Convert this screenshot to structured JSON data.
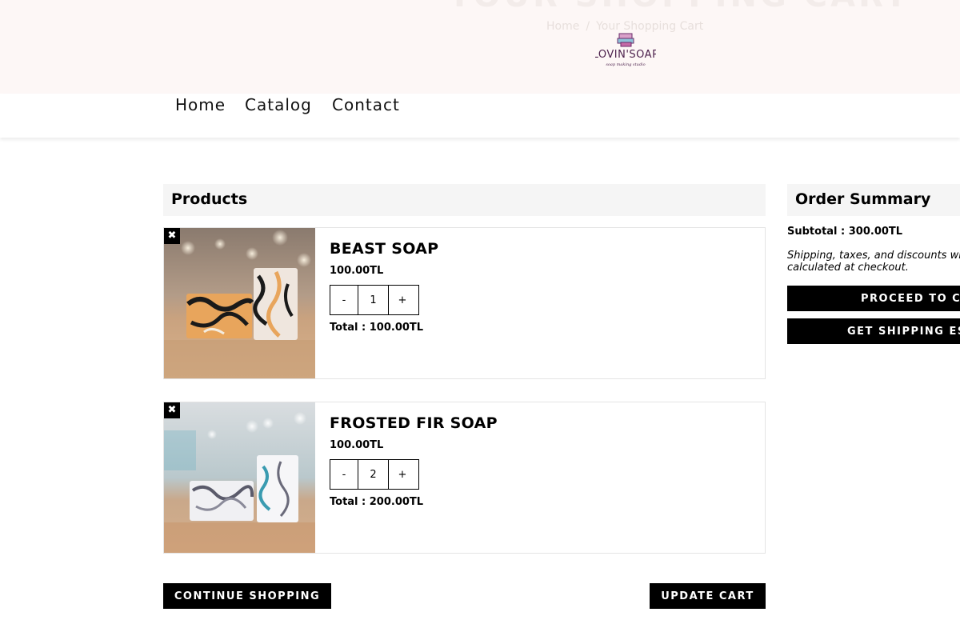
{
  "header": {
    "page_heading": "YOUR SHOPPING CART",
    "breadcrumb": [
      "Home",
      "Your Shopping Cart"
    ],
    "breadcrumb_sep": "/",
    "logo_text": "LOVIN'SOAP",
    "logo_tagline": "soap making studio"
  },
  "nav": {
    "items": [
      "Home",
      "Catalog",
      "Contact"
    ]
  },
  "products_section": {
    "heading": "Products",
    "items": [
      {
        "name": "BEAST SOAP",
        "price": "100.00TL",
        "qty_minus": "-",
        "qty": "1",
        "qty_plus": "+",
        "total": "Total : 100.00TL",
        "remove_icon": "✖"
      },
      {
        "name": "FROSTED FIR SOAP",
        "price": "100.00TL",
        "qty_minus": "-",
        "qty": "2",
        "qty_plus": "+",
        "total": "Total : 200.00TL",
        "remove_icon": "✖"
      }
    ],
    "continue_label": "CONTINUE SHOPPING",
    "update_label": "UPDATE CART"
  },
  "summary": {
    "heading": "Order Summary",
    "subtotal": "Subtotal : 300.00TL",
    "note": "Shipping, taxes, and discounts will be calculated at checkout.",
    "proceed_label": "PROCEED TO CHECKOUT",
    "shipping_label": "GET SHIPPING ESTIMATE"
  },
  "colors": {
    "banner_bg": "#fdf7f6",
    "button_bg": "#000000",
    "section_head_bg": "#f5f5f5",
    "logo_accent": "#6b2c6b"
  }
}
